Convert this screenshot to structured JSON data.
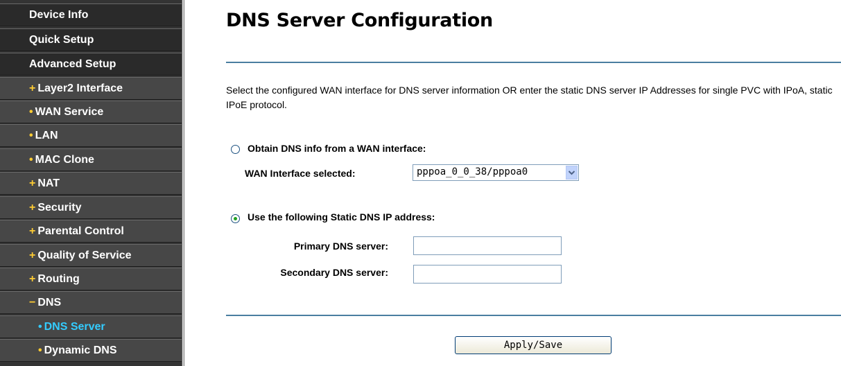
{
  "sidebar": {
    "items": [
      {
        "label": "Device Info",
        "bullet": ""
      },
      {
        "label": "Quick Setup",
        "bullet": ""
      },
      {
        "label": "Advanced Setup",
        "bullet": ""
      },
      {
        "label": "Layer2 Interface",
        "bullet": "+"
      },
      {
        "label": "WAN Service",
        "bullet": "•"
      },
      {
        "label": "LAN",
        "bullet": "•"
      },
      {
        "label": "MAC Clone",
        "bullet": "•"
      },
      {
        "label": "NAT",
        "bullet": "+"
      },
      {
        "label": "Security",
        "bullet": "+"
      },
      {
        "label": "Parental Control",
        "bullet": "+"
      },
      {
        "label": "Quality of Service",
        "bullet": "+"
      },
      {
        "label": "Routing",
        "bullet": "+"
      },
      {
        "label": "DNS",
        "bullet": "−"
      },
      {
        "label": "DNS Server",
        "bullet": "•"
      },
      {
        "label": "Dynamic DNS",
        "bullet": "•"
      }
    ],
    "active_color": "#33ccff",
    "bullet_color": "#ffcc33"
  },
  "main": {
    "title": "DNS Server Configuration",
    "description": "Select the configured WAN interface for DNS server information OR enter the static DNS server IP Addresses for single PVC with IPoA, static IPoE protocol.",
    "option_wan_label": "Obtain DNS info from a WAN interface:",
    "option_wan_selected": false,
    "wan_interface_label": "WAN Interface selected:",
    "wan_interface_value": "pppoa_0_0_38/pppoa0",
    "option_static_label": "Use the following Static DNS IP address:",
    "option_static_selected": true,
    "primary_dns_label": "Primary DNS server:",
    "primary_dns_value": "",
    "secondary_dns_label": "Secondary DNS server:",
    "secondary_dns_value": "",
    "apply_button_label": "Apply/Save"
  }
}
